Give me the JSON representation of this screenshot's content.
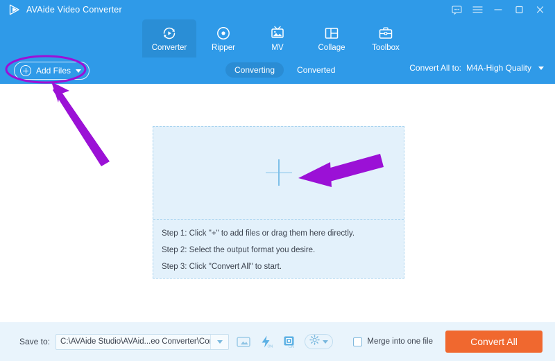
{
  "window": {
    "app_title": "AVAide Video Converter",
    "logo_icon": "play-triangle-icon",
    "controls": [
      {
        "name": "feedback-icon",
        "label": "Feedback"
      },
      {
        "name": "menu-icon",
        "label": "Menu"
      },
      {
        "name": "minimize-icon",
        "label": "Minimize"
      },
      {
        "name": "maximize-icon",
        "label": "Maximize"
      },
      {
        "name": "close-icon",
        "label": "Close"
      }
    ]
  },
  "nav": {
    "tabs": [
      {
        "label": "Converter",
        "icon": "convert-circle-arrow-icon",
        "active": true
      },
      {
        "label": "Ripper",
        "icon": "disc-icon",
        "active": false
      },
      {
        "label": "MV",
        "icon": "tv-image-icon",
        "active": false
      },
      {
        "label": "Collage",
        "icon": "grid-layout-icon",
        "active": false
      },
      {
        "label": "Toolbox",
        "icon": "briefcase-icon",
        "active": false
      }
    ]
  },
  "toolbar": {
    "add_files_label": "Add Files",
    "add_files_icon": "plus-circle-icon",
    "add_files_caret_icon": "chevron-down-icon",
    "segments": [
      {
        "label": "Converting",
        "active": true
      },
      {
        "label": "Converted",
        "active": false
      }
    ],
    "convert_all_to_label": "Convert All to:",
    "format_value": "M4A-High Quality",
    "format_caret_icon": "chevron-down-icon"
  },
  "main": {
    "dropzone_plus_icon": "plus-icon",
    "steps": [
      "Step 1: Click \"+\" to add files or drag them here directly.",
      "Step 2: Select the output format you desire.",
      "Step 3: Click \"Convert All\" to start."
    ]
  },
  "bottom": {
    "save_to_label": "Save to:",
    "save_to_path": "C:\\AVAide Studio\\AVAid...eo Converter\\Converted",
    "path_caret_icon": "chevron-down-icon",
    "icons": [
      {
        "name": "open-folder-icon",
        "label": "Open output folder"
      },
      {
        "name": "hardware-acceleration-icon",
        "label": "ON"
      },
      {
        "name": "snapshot-icon",
        "label": "ON"
      },
      {
        "name": "settings-gear-icon",
        "label": "Settings"
      }
    ],
    "merge_label": "Merge into one file",
    "merge_checked": false,
    "convert_all_button": "Convert All"
  },
  "annotations": {
    "highlight_color": "#9B11D6",
    "ellipse_target": "add-files-button",
    "arrows": [
      {
        "name": "arrow-to-add-files",
        "points_at": "add-files-button"
      },
      {
        "name": "arrow-to-dropzone-plus",
        "points_at": "dropzone-plus"
      }
    ]
  },
  "colors": {
    "header_blue": "#2f9ae8",
    "accent_orange": "#f0682f",
    "dropzone_fill": "#e3f1fb",
    "bottom_bar": "#e9f4fc"
  }
}
